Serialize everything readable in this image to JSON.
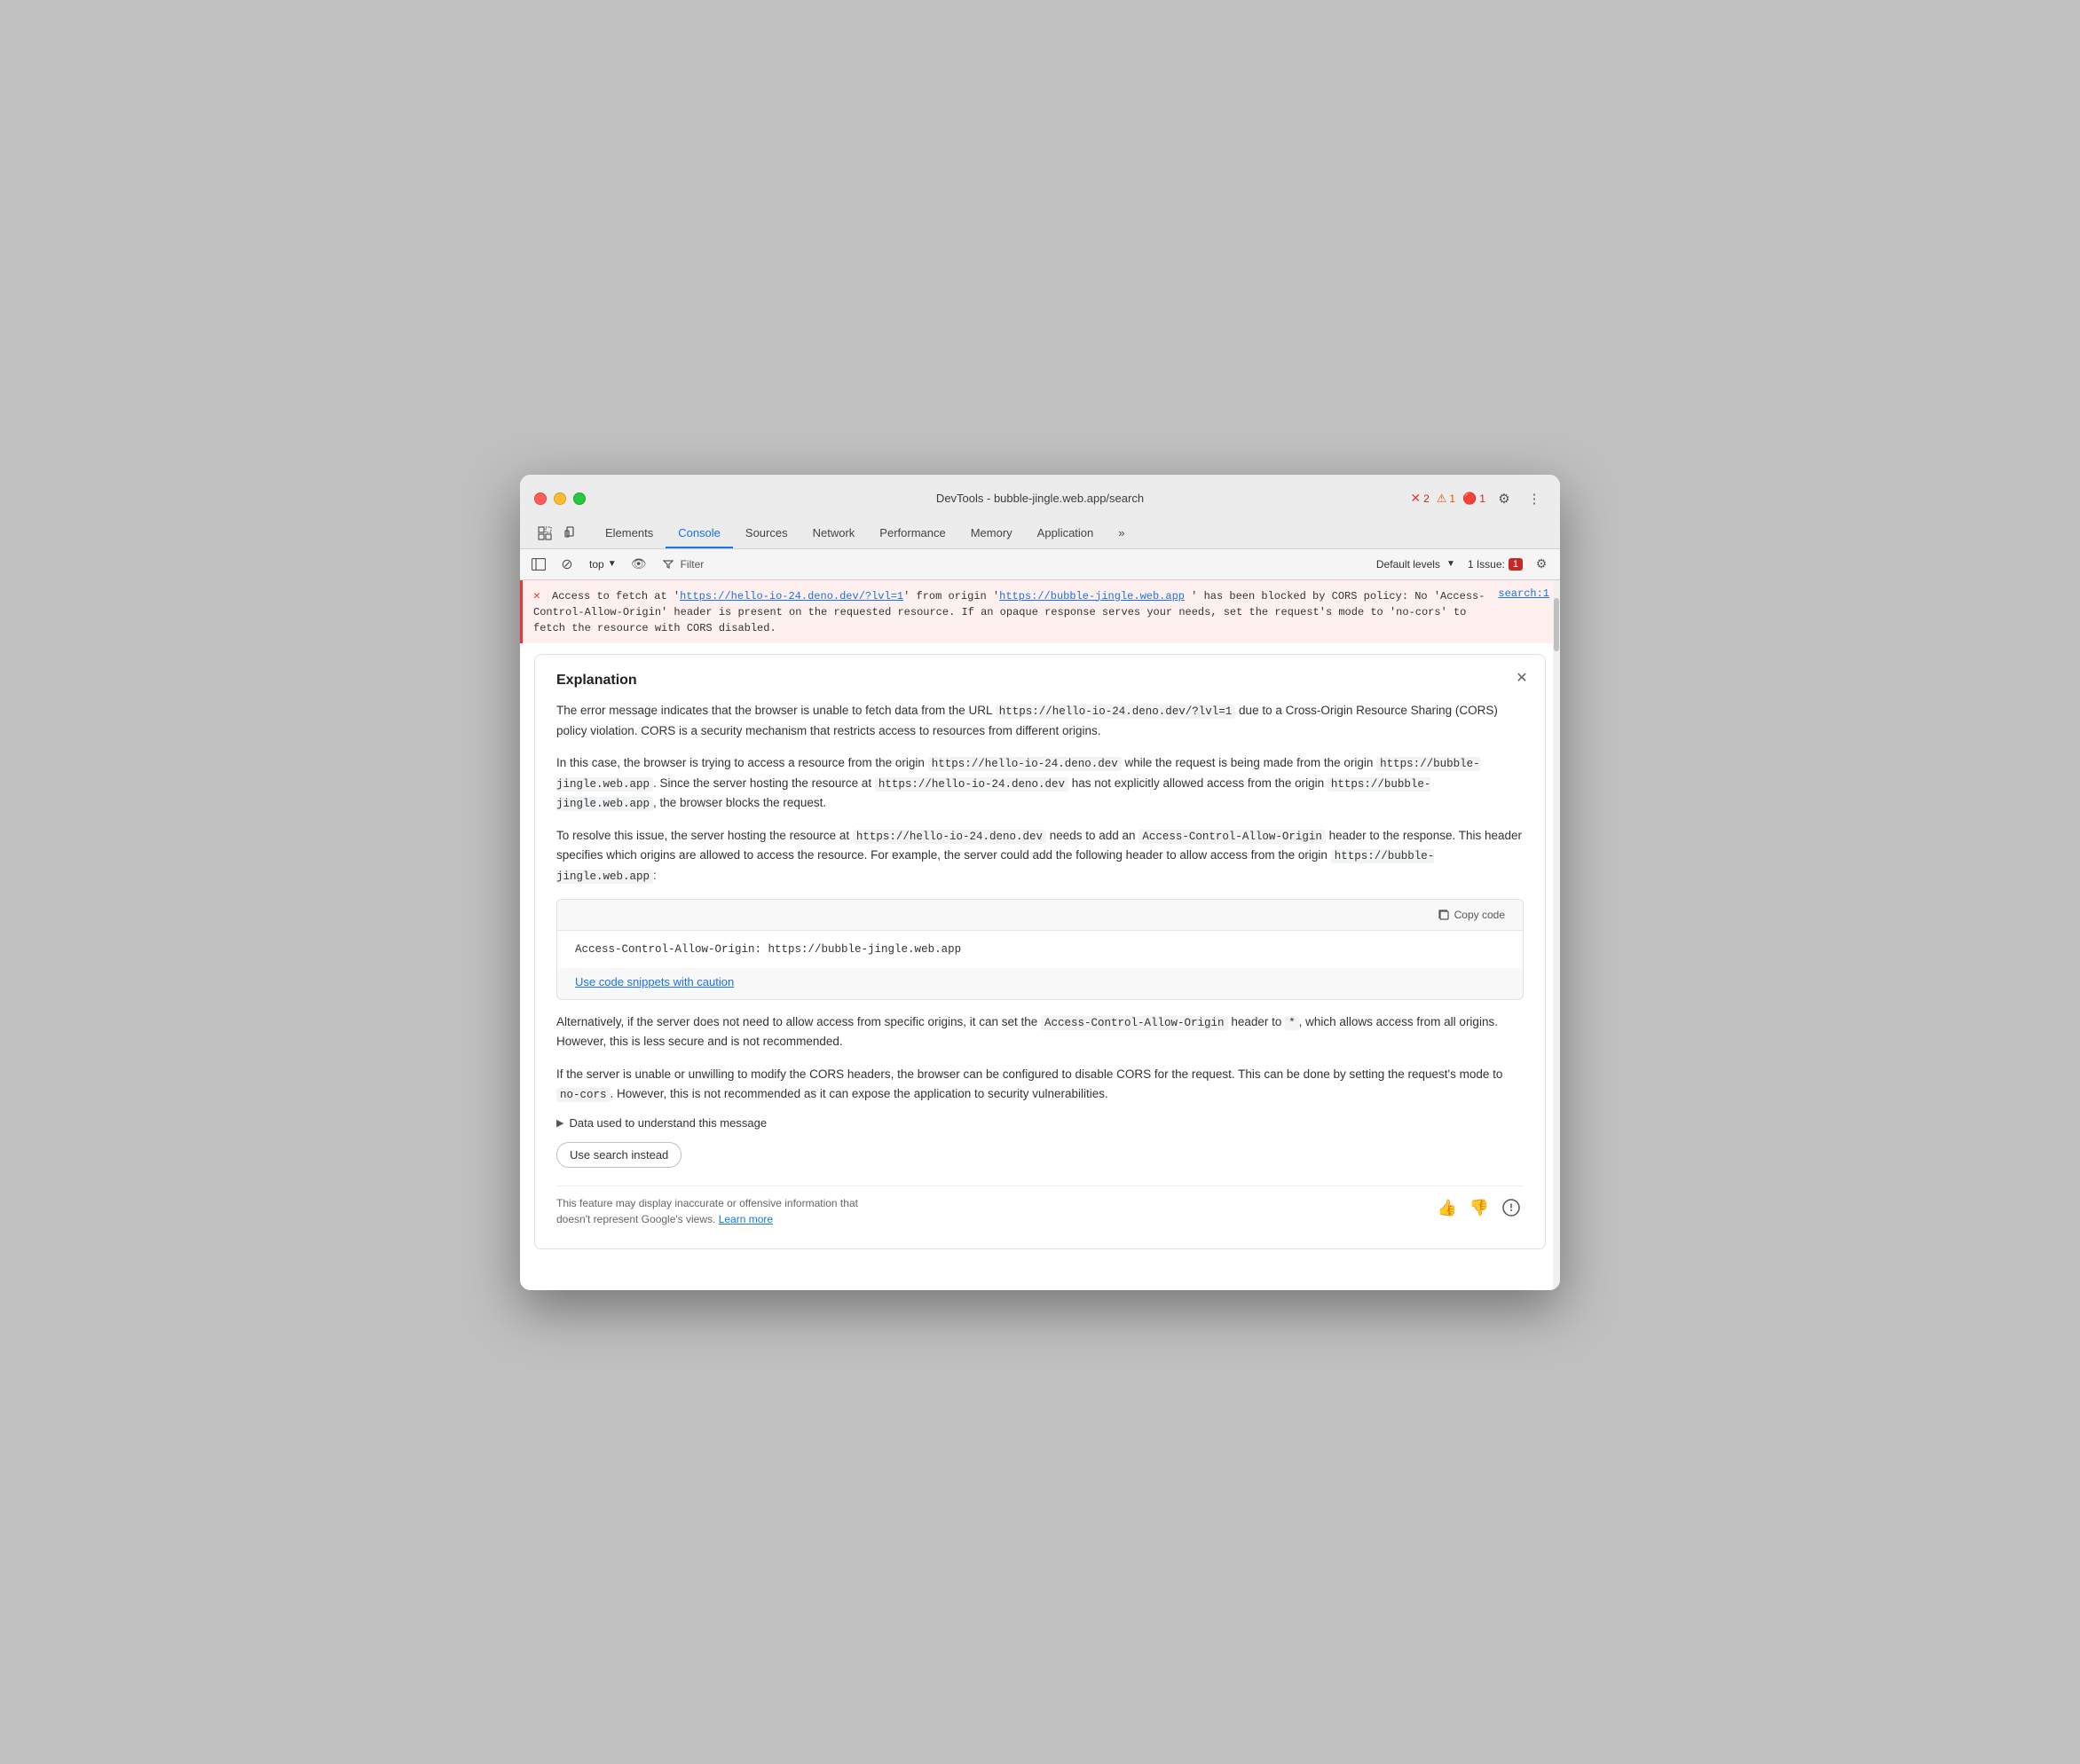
{
  "window": {
    "title": "DevTools - bubble-jingle.web.app/search"
  },
  "tabs": {
    "items": [
      {
        "label": "Elements",
        "active": false
      },
      {
        "label": "Console",
        "active": true
      },
      {
        "label": "Sources",
        "active": false
      },
      {
        "label": "Network",
        "active": false
      },
      {
        "label": "Performance",
        "active": false
      },
      {
        "label": "Memory",
        "active": false
      },
      {
        "label": "Application",
        "active": false
      }
    ],
    "more_label": "»"
  },
  "badges": {
    "error_count": "2",
    "warn_count": "1",
    "info_count": "1"
  },
  "toolbar": {
    "top_label": "top",
    "filter_label": "Filter",
    "levels_label": "Default levels",
    "issues_label": "1 Issue:",
    "issues_count": "1"
  },
  "error_message": {
    "prefix": "Access to fetch at '",
    "url1": "https://hello-io-24.deno.dev/?lvl=1",
    "middle": "' from origin '",
    "url2": "https://bubble-jingle.web.app",
    "suffix": "' has been blocked by CORS policy: No 'Access-Control-Allow-Origin' header is present on the requested resource. If an opaque response serves your needs, set the request's mode to 'no-cors' to fetch the resource with CORS disabled.",
    "source": "search:1"
  },
  "explanation": {
    "title": "Explanation",
    "paragraph1": "The error message indicates that the browser is unable to fetch data from the URL https://hello-io-24.deno.dev/?lvl=1 due to a Cross-Origin Resource Sharing (CORS) policy violation. CORS is a security mechanism that restricts access to resources from different origins.",
    "paragraph2_before": "In this case, the browser is trying to access a resource from the origin ",
    "paragraph2_code1": "https://hello-io-24.deno.dev",
    "paragraph2_middle": " while the request is being made from the origin ",
    "paragraph2_code2": "https://bubble-jingle.web.app",
    "paragraph2_after": ". Since the server hosting the resource at ",
    "paragraph2_code3": "https://hello-io-24.deno.dev",
    "paragraph2_end": " has not explicitly allowed access from the origin ",
    "paragraph2_code4": "https://bubble-jingle.web.app",
    "paragraph2_final": ", the browser blocks the request.",
    "paragraph3_before": "To resolve this issue, the server hosting the resource at ",
    "paragraph3_code1": "https://hello-io-24.deno.dev",
    "paragraph3_middle": " needs to add an ",
    "paragraph3_code2": "Access-Control-Allow-Origin",
    "paragraph3_after": " header to the response. This header specifies which origins are allowed to access the resource. For example, the server could add the following header to allow access from the origin ",
    "paragraph3_code3": "https://bubble-jingle.web.app",
    "paragraph3_colon": ":",
    "copy_code_label": "Copy code",
    "code_snippet": "Access-Control-Allow-Origin: https://bubble-jingle.web.app",
    "caution_link": "Use code snippets with caution",
    "paragraph4_before": "Alternatively, if the server does not need to allow access from specific origins, it can set the ",
    "paragraph4_code1": "Access-Control-Allow-Origin",
    "paragraph4_middle": " header to ",
    "paragraph4_code2": "*",
    "paragraph4_after": ", which allows access from all origins. However, this is less secure and is not recommended.",
    "paragraph5_before": "If the server is unable or unwilling to modify the CORS headers, the browser can be configured to disable CORS for the request. This can be done by setting the request's mode to ",
    "paragraph5_code1": "no-cors",
    "paragraph5_after": ". However, this is not recommended as it can expose the application to security vulnerabilities.",
    "data_used_label": "Data used to understand this message",
    "use_search_label": "Use search instead",
    "disclaimer": "This feature may display inaccurate or offensive information that doesn't represent Google's views.",
    "learn_more_label": "Learn more"
  }
}
